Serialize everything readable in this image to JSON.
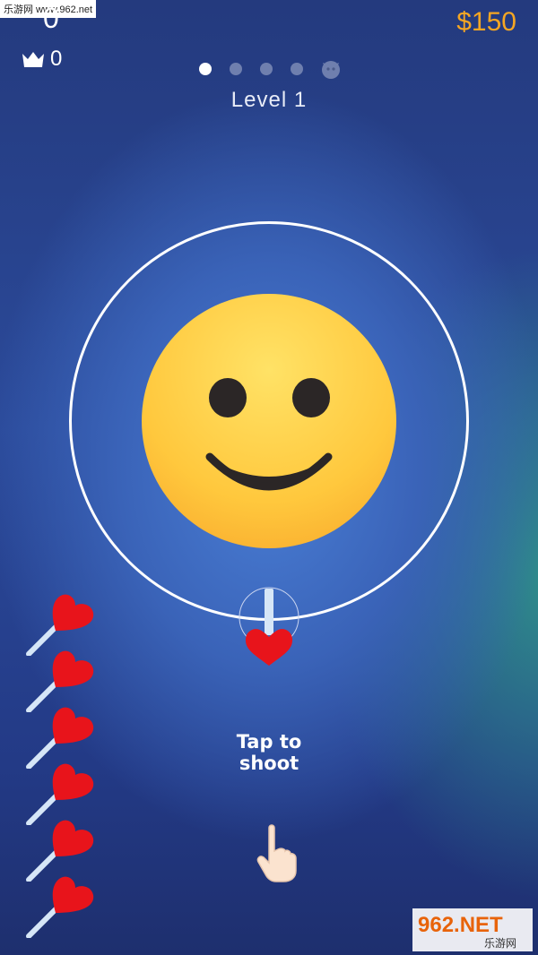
{
  "watermark_top": "乐游网 www.962.net",
  "hud": {
    "score": "0",
    "best_score": "0",
    "money": "$150",
    "crown_icon": "crown-icon"
  },
  "progress": {
    "stages": 5,
    "current_stage": 1,
    "boss_icon": "boss-face-icon"
  },
  "level_label": "Level 1",
  "target": {
    "icon": "smiley-face-icon"
  },
  "instruction": {
    "line1": "Tap to",
    "line2": "shoot",
    "hand_icon": "pointing-hand-icon"
  },
  "ammo": {
    "remaining": 6,
    "icon": "heart-lollipop-icon"
  },
  "watermark_bottom": {
    "line1": "962.NET",
    "line2": "乐游网"
  },
  "colors": {
    "money": "#f5a623",
    "heart": "#e8141b",
    "face": "#ffc83d"
  }
}
